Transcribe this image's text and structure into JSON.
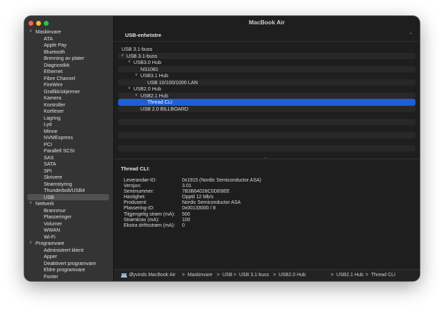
{
  "window": {
    "title": "MacBook Air"
  },
  "sidebar": {
    "items": [
      {
        "label": "Maskinvare",
        "level": "cat",
        "expanded": true
      },
      {
        "label": "ATA",
        "level": "sub"
      },
      {
        "label": "Apple Pay",
        "level": "sub"
      },
      {
        "label": "Bluetooth",
        "level": "sub"
      },
      {
        "label": "Brenning av plater",
        "level": "sub"
      },
      {
        "label": "Diagnostikk",
        "level": "sub"
      },
      {
        "label": "Ethernet",
        "level": "sub"
      },
      {
        "label": "Fibre Channel",
        "level": "sub"
      },
      {
        "label": "FireWire",
        "level": "sub"
      },
      {
        "label": "Grafikk/skjermer",
        "level": "sub"
      },
      {
        "label": "Kamera",
        "level": "sub"
      },
      {
        "label": "Kontroller",
        "level": "sub"
      },
      {
        "label": "Kortleser",
        "level": "sub"
      },
      {
        "label": "Lagring",
        "level": "sub"
      },
      {
        "label": "Lyd",
        "level": "sub"
      },
      {
        "label": "Minne",
        "level": "sub"
      },
      {
        "label": "NVMExpress",
        "level": "sub"
      },
      {
        "label": "PCI",
        "level": "sub"
      },
      {
        "label": "Parallell SCSI",
        "level": "sub"
      },
      {
        "label": "SAS",
        "level": "sub"
      },
      {
        "label": "SATA",
        "level": "sub"
      },
      {
        "label": "SPI",
        "level": "sub"
      },
      {
        "label": "Skrivere",
        "level": "sub"
      },
      {
        "label": "Strømstyring",
        "level": "sub"
      },
      {
        "label": "Thunderbolt/USB4",
        "level": "sub"
      },
      {
        "label": "USB",
        "level": "sub",
        "selected": true
      },
      {
        "label": "Nettverk",
        "level": "cat",
        "expanded": true
      },
      {
        "label": "Brannmur",
        "level": "sub"
      },
      {
        "label": "Plasseringer",
        "level": "sub"
      },
      {
        "label": "Volumer",
        "level": "sub"
      },
      {
        "label": "WWAN",
        "level": "sub"
      },
      {
        "label": "Wi-Fi",
        "level": "sub"
      },
      {
        "label": "Programvare",
        "level": "cat",
        "expanded": true
      },
      {
        "label": "Administrert klient",
        "level": "sub"
      },
      {
        "label": "Apper",
        "level": "sub"
      },
      {
        "label": "Deaktivert programvare",
        "level": "sub"
      },
      {
        "label": "Eldre programvare",
        "level": "sub"
      },
      {
        "label": "Fonter",
        "level": "sub"
      }
    ]
  },
  "usb": {
    "header": "USB-enhetstre",
    "tree": [
      {
        "label": "USB 3.1-buss",
        "depth": 0,
        "chevron": false
      },
      {
        "label": "USB 3.1-buss",
        "depth": 0,
        "chevron": true
      },
      {
        "label": "USB3.0 Hub",
        "depth": 1,
        "chevron": true
      },
      {
        "label": "NS1081",
        "depth": 2,
        "chevron": false
      },
      {
        "label": "USB3.1 Hub",
        "depth": 2,
        "chevron": true
      },
      {
        "label": "USB 10/100/1000 LAN",
        "depth": 3,
        "chevron": false
      },
      {
        "label": "USB2.0 Hub",
        "depth": 1,
        "chevron": true
      },
      {
        "label": "USB2.1 Hub",
        "depth": 2,
        "chevron": true
      },
      {
        "label": "Thread CLI",
        "depth": 3,
        "chevron": false,
        "selected": true
      },
      {
        "label": "USB 2.0 BILLBOARD",
        "depth": 2,
        "chevron": false
      }
    ]
  },
  "details": {
    "title": "Thread CLI:",
    "fields": [
      {
        "key": "Leverandør-ID:",
        "value": "0x1915  (Nordic Semiconductor ASA)"
      },
      {
        "key": "Versjon:",
        "value": "3.01"
      },
      {
        "key": "Serienummer:",
        "value": "7B3B64028C0DE6EE"
      },
      {
        "key": "Hastighet:",
        "value": "Opptil 12 Mb/s"
      },
      {
        "key": "Produsent:",
        "value": "Nordic Semiconductor ASA"
      },
      {
        "key": "Plassering-ID:",
        "value": "0x00133000 / 8"
      },
      {
        "key": "Tilgjengelig strøm (mA):",
        "value": "500"
      },
      {
        "key": "Strømkrav (mA):",
        "value": "100"
      },
      {
        "key": "Ekstra driftsstrøm (mA):",
        "value": "0"
      }
    ]
  },
  "pathbar": {
    "crumbs": [
      "Øyvinds MacBook Air",
      "Maskinvare",
      "USB",
      "USB 3.1-buss",
      "USB2.0 Hub",
      "USB2.1 Hub",
      "Thread CLI"
    ],
    "separator": ">"
  },
  "icons": {
    "chevron_expanded": "chevron-down-icon",
    "chevron_collapse": "chevron-up-icon",
    "laptop": "laptop-icon"
  }
}
